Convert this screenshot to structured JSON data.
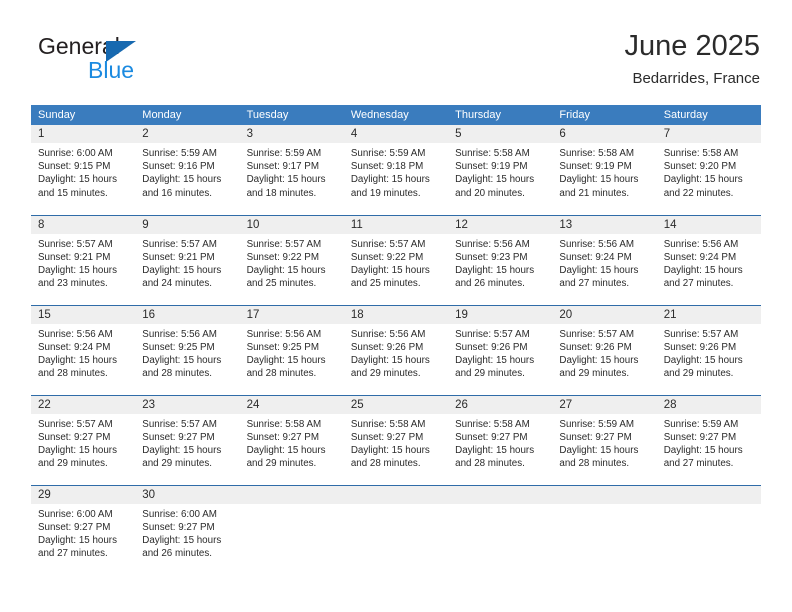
{
  "brand": {
    "name_part1": "General",
    "name_part2": "Blue",
    "triangle_color": "#1769b0",
    "blue_color": "#1b8ae0"
  },
  "header": {
    "title": "June 2025",
    "subtitle": "Bedarrides, France"
  },
  "theme": {
    "header_row_bg": "#3a7cbe",
    "header_row_text": "#ffffff",
    "daynum_bg": "#efefef",
    "row_divider": "#2f6ca8",
    "body_text": "#2b2b2b"
  },
  "weekday_headers": [
    "Sunday",
    "Monday",
    "Tuesday",
    "Wednesday",
    "Thursday",
    "Friday",
    "Saturday"
  ],
  "weeks": [
    [
      {
        "day": "1",
        "sunrise": "Sunrise: 6:00 AM",
        "sunset": "Sunset: 9:15 PM",
        "daylight1": "Daylight: 15 hours",
        "daylight2": "and 15 minutes."
      },
      {
        "day": "2",
        "sunrise": "Sunrise: 5:59 AM",
        "sunset": "Sunset: 9:16 PM",
        "daylight1": "Daylight: 15 hours",
        "daylight2": "and 16 minutes."
      },
      {
        "day": "3",
        "sunrise": "Sunrise: 5:59 AM",
        "sunset": "Sunset: 9:17 PM",
        "daylight1": "Daylight: 15 hours",
        "daylight2": "and 18 minutes."
      },
      {
        "day": "4",
        "sunrise": "Sunrise: 5:59 AM",
        "sunset": "Sunset: 9:18 PM",
        "daylight1": "Daylight: 15 hours",
        "daylight2": "and 19 minutes."
      },
      {
        "day": "5",
        "sunrise": "Sunrise: 5:58 AM",
        "sunset": "Sunset: 9:19 PM",
        "daylight1": "Daylight: 15 hours",
        "daylight2": "and 20 minutes."
      },
      {
        "day": "6",
        "sunrise": "Sunrise: 5:58 AM",
        "sunset": "Sunset: 9:19 PM",
        "daylight1": "Daylight: 15 hours",
        "daylight2": "and 21 minutes."
      },
      {
        "day": "7",
        "sunrise": "Sunrise: 5:58 AM",
        "sunset": "Sunset: 9:20 PM",
        "daylight1": "Daylight: 15 hours",
        "daylight2": "and 22 minutes."
      }
    ],
    [
      {
        "day": "8",
        "sunrise": "Sunrise: 5:57 AM",
        "sunset": "Sunset: 9:21 PM",
        "daylight1": "Daylight: 15 hours",
        "daylight2": "and 23 minutes."
      },
      {
        "day": "9",
        "sunrise": "Sunrise: 5:57 AM",
        "sunset": "Sunset: 9:21 PM",
        "daylight1": "Daylight: 15 hours",
        "daylight2": "and 24 minutes."
      },
      {
        "day": "10",
        "sunrise": "Sunrise: 5:57 AM",
        "sunset": "Sunset: 9:22 PM",
        "daylight1": "Daylight: 15 hours",
        "daylight2": "and 25 minutes."
      },
      {
        "day": "11",
        "sunrise": "Sunrise: 5:57 AM",
        "sunset": "Sunset: 9:22 PM",
        "daylight1": "Daylight: 15 hours",
        "daylight2": "and 25 minutes."
      },
      {
        "day": "12",
        "sunrise": "Sunrise: 5:56 AM",
        "sunset": "Sunset: 9:23 PM",
        "daylight1": "Daylight: 15 hours",
        "daylight2": "and 26 minutes."
      },
      {
        "day": "13",
        "sunrise": "Sunrise: 5:56 AM",
        "sunset": "Sunset: 9:24 PM",
        "daylight1": "Daylight: 15 hours",
        "daylight2": "and 27 minutes."
      },
      {
        "day": "14",
        "sunrise": "Sunrise: 5:56 AM",
        "sunset": "Sunset: 9:24 PM",
        "daylight1": "Daylight: 15 hours",
        "daylight2": "and 27 minutes."
      }
    ],
    [
      {
        "day": "15",
        "sunrise": "Sunrise: 5:56 AM",
        "sunset": "Sunset: 9:24 PM",
        "daylight1": "Daylight: 15 hours",
        "daylight2": "and 28 minutes."
      },
      {
        "day": "16",
        "sunrise": "Sunrise: 5:56 AM",
        "sunset": "Sunset: 9:25 PM",
        "daylight1": "Daylight: 15 hours",
        "daylight2": "and 28 minutes."
      },
      {
        "day": "17",
        "sunrise": "Sunrise: 5:56 AM",
        "sunset": "Sunset: 9:25 PM",
        "daylight1": "Daylight: 15 hours",
        "daylight2": "and 28 minutes."
      },
      {
        "day": "18",
        "sunrise": "Sunrise: 5:56 AM",
        "sunset": "Sunset: 9:26 PM",
        "daylight1": "Daylight: 15 hours",
        "daylight2": "and 29 minutes."
      },
      {
        "day": "19",
        "sunrise": "Sunrise: 5:57 AM",
        "sunset": "Sunset: 9:26 PM",
        "daylight1": "Daylight: 15 hours",
        "daylight2": "and 29 minutes."
      },
      {
        "day": "20",
        "sunrise": "Sunrise: 5:57 AM",
        "sunset": "Sunset: 9:26 PM",
        "daylight1": "Daylight: 15 hours",
        "daylight2": "and 29 minutes."
      },
      {
        "day": "21",
        "sunrise": "Sunrise: 5:57 AM",
        "sunset": "Sunset: 9:26 PM",
        "daylight1": "Daylight: 15 hours",
        "daylight2": "and 29 minutes."
      }
    ],
    [
      {
        "day": "22",
        "sunrise": "Sunrise: 5:57 AM",
        "sunset": "Sunset: 9:27 PM",
        "daylight1": "Daylight: 15 hours",
        "daylight2": "and 29 minutes."
      },
      {
        "day": "23",
        "sunrise": "Sunrise: 5:57 AM",
        "sunset": "Sunset: 9:27 PM",
        "daylight1": "Daylight: 15 hours",
        "daylight2": "and 29 minutes."
      },
      {
        "day": "24",
        "sunrise": "Sunrise: 5:58 AM",
        "sunset": "Sunset: 9:27 PM",
        "daylight1": "Daylight: 15 hours",
        "daylight2": "and 29 minutes."
      },
      {
        "day": "25",
        "sunrise": "Sunrise: 5:58 AM",
        "sunset": "Sunset: 9:27 PM",
        "daylight1": "Daylight: 15 hours",
        "daylight2": "and 28 minutes."
      },
      {
        "day": "26",
        "sunrise": "Sunrise: 5:58 AM",
        "sunset": "Sunset: 9:27 PM",
        "daylight1": "Daylight: 15 hours",
        "daylight2": "and 28 minutes."
      },
      {
        "day": "27",
        "sunrise": "Sunrise: 5:59 AM",
        "sunset": "Sunset: 9:27 PM",
        "daylight1": "Daylight: 15 hours",
        "daylight2": "and 28 minutes."
      },
      {
        "day": "28",
        "sunrise": "Sunrise: 5:59 AM",
        "sunset": "Sunset: 9:27 PM",
        "daylight1": "Daylight: 15 hours",
        "daylight2": "and 27 minutes."
      }
    ],
    [
      {
        "day": "29",
        "sunrise": "Sunrise: 6:00 AM",
        "sunset": "Sunset: 9:27 PM",
        "daylight1": "Daylight: 15 hours",
        "daylight2": "and 27 minutes."
      },
      {
        "day": "30",
        "sunrise": "Sunrise: 6:00 AM",
        "sunset": "Sunset: 9:27 PM",
        "daylight1": "Daylight: 15 hours",
        "daylight2": "and 26 minutes."
      },
      {
        "day": "",
        "sunrise": "",
        "sunset": "",
        "daylight1": "",
        "daylight2": ""
      },
      {
        "day": "",
        "sunrise": "",
        "sunset": "",
        "daylight1": "",
        "daylight2": ""
      },
      {
        "day": "",
        "sunrise": "",
        "sunset": "",
        "daylight1": "",
        "daylight2": ""
      },
      {
        "day": "",
        "sunrise": "",
        "sunset": "",
        "daylight1": "",
        "daylight2": ""
      },
      {
        "day": "",
        "sunrise": "",
        "sunset": "",
        "daylight1": "",
        "daylight2": ""
      }
    ]
  ]
}
